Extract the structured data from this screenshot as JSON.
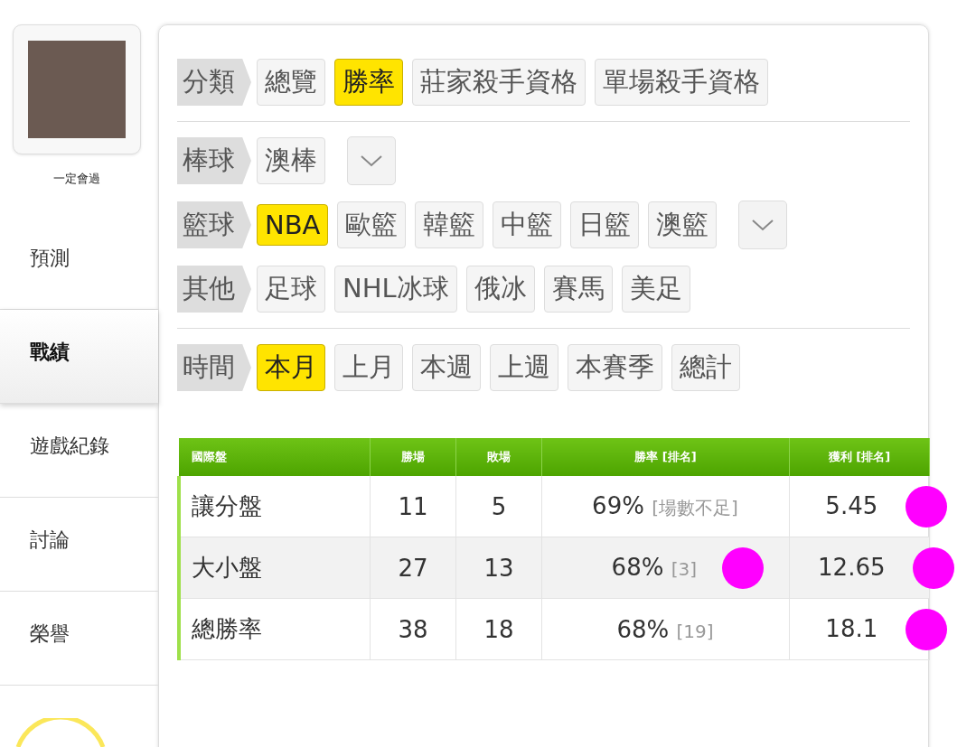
{
  "profile": {
    "name": "一定會過"
  },
  "sidebar": {
    "items": [
      {
        "label": "預測",
        "selected": false
      },
      {
        "label": "戰績",
        "selected": true
      },
      {
        "label": "遊戲紀錄",
        "selected": false
      },
      {
        "label": "討論",
        "selected": false
      },
      {
        "label": "榮譽",
        "selected": false
      }
    ]
  },
  "filters": [
    {
      "label": "分類",
      "has_dropdown": false,
      "divider_after": true,
      "options": [
        {
          "label": "總覽",
          "selected": false
        },
        {
          "label": "勝率",
          "selected": true
        },
        {
          "label": "莊家殺手資格",
          "selected": false
        },
        {
          "label": "單場殺手資格",
          "selected": false
        }
      ]
    },
    {
      "label": "棒球",
      "has_dropdown": true,
      "divider_after": false,
      "options": [
        {
          "label": "澳棒",
          "selected": false
        }
      ]
    },
    {
      "label": "籃球",
      "has_dropdown": true,
      "divider_after": false,
      "options": [
        {
          "label": "NBA",
          "selected": true
        },
        {
          "label": "歐籃",
          "selected": false
        },
        {
          "label": "韓籃",
          "selected": false
        },
        {
          "label": "中籃",
          "selected": false
        },
        {
          "label": "日籃",
          "selected": false
        },
        {
          "label": "澳籃",
          "selected": false
        }
      ]
    },
    {
      "label": "其他",
      "has_dropdown": false,
      "divider_after": true,
      "options": [
        {
          "label": "足球",
          "selected": false
        },
        {
          "label": "NHL冰球",
          "selected": false
        },
        {
          "label": "俄冰",
          "selected": false
        },
        {
          "label": "賽馬",
          "selected": false
        },
        {
          "label": "美足",
          "selected": false
        }
      ]
    },
    {
      "label": "時間",
      "has_dropdown": false,
      "divider_after": false,
      "options": [
        {
          "label": "本月",
          "selected": true
        },
        {
          "label": "上月",
          "selected": false
        },
        {
          "label": "本週",
          "selected": false
        },
        {
          "label": "上週",
          "selected": false
        },
        {
          "label": "本賽季",
          "selected": false
        },
        {
          "label": "總計",
          "selected": false
        }
      ]
    }
  ],
  "table": {
    "columns": [
      "國際盤",
      "勝場",
      "敗場",
      "勝率 [排名]",
      "獲利 [排名]"
    ],
    "rows": [
      {
        "type": "讓分盤",
        "wins": "11",
        "losses": "5",
        "rate": "69%",
        "rate_rank": "[場數不足]",
        "rate_scribbled": false,
        "profit": "5.45",
        "profit_scribbled": true
      },
      {
        "type": "大小盤",
        "wins": "27",
        "losses": "13",
        "rate": "68%",
        "rate_rank": "[3]",
        "rate_scribbled": true,
        "profit": "12.65",
        "profit_scribbled": true
      },
      {
        "type": "總勝率",
        "wins": "38",
        "losses": "18",
        "rate": "68%",
        "rate_rank": "[19]",
        "rate_scribbled": false,
        "profit": "18.1",
        "profit_scribbled": true
      }
    ]
  }
}
